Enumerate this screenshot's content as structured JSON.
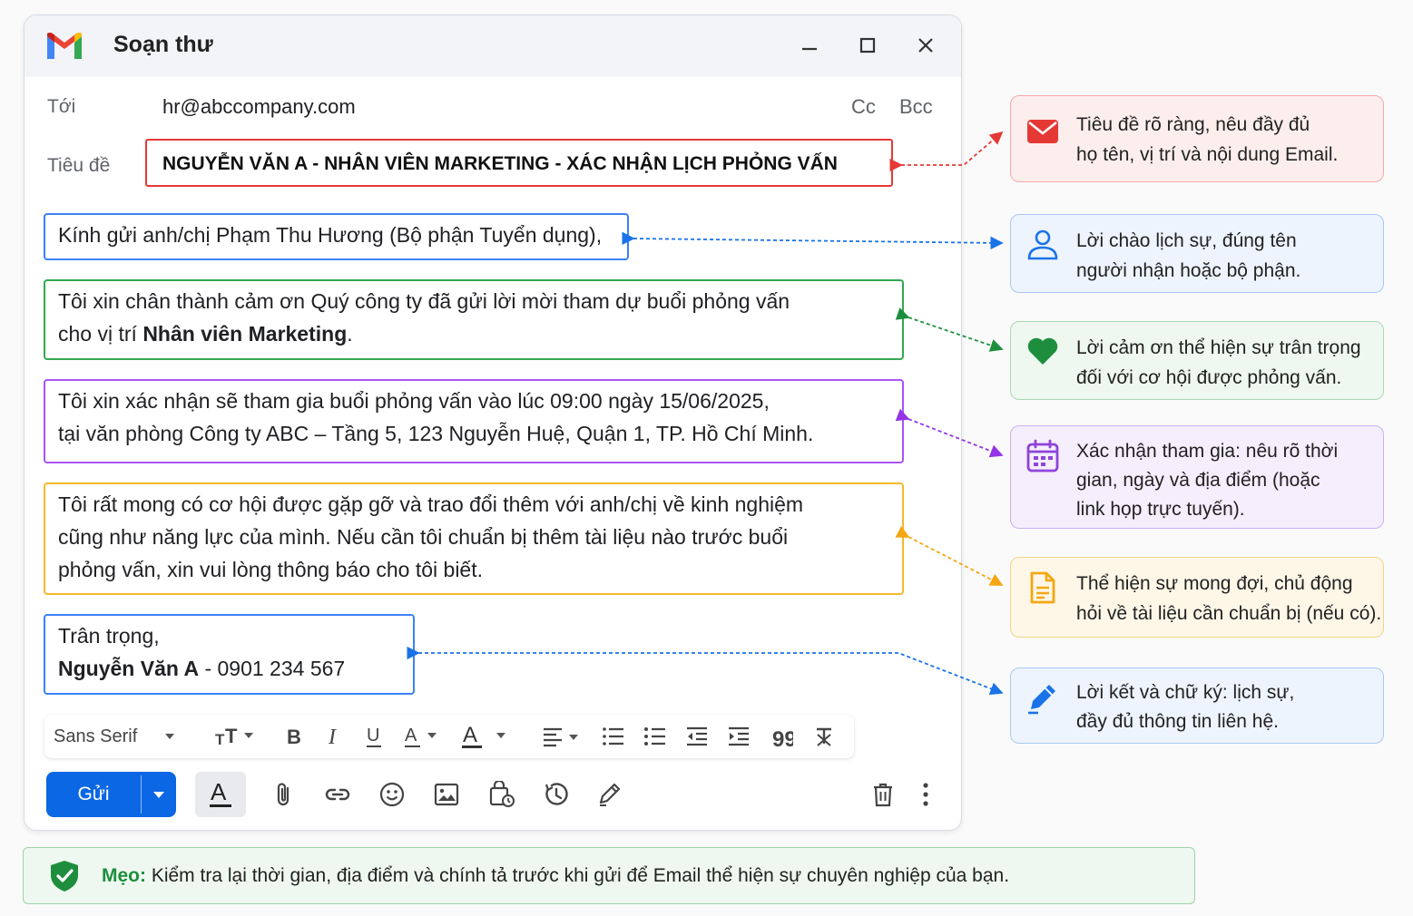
{
  "window": {
    "title": "Soạn thư"
  },
  "compose": {
    "to_label": "Tới",
    "to_value": "hr@abccompany.com",
    "cc": "Cc",
    "bcc": "Bcc",
    "subject_label": "Tiêu đề",
    "subject_value": "NGUYỄN VĂN A - NHÂN VIÊN MARKETING - XÁC NHẬN LỊCH PHỎNG VẤN"
  },
  "body": {
    "greeting": "Kính gửi anh/chị Phạm Thu Hương (Bộ phận Tuyển dụng),",
    "thanks_pre": "Tôi xin chân thành cảm ơn Quý công ty đã gửi lời mời tham dự buổi phỏng vấn",
    "thanks_line2_pre": "cho vị trí ",
    "thanks_bold": "Nhân viên Marketing",
    "thanks_post": ".",
    "confirm_line1": "Tôi xin xác nhận sẽ tham gia buổi phỏng vấn vào lúc 09:00 ngày 15/06/2025,",
    "confirm_line2": "tại văn phòng Công ty ABC – Tầng 5, 123 Nguyễn Huệ, Quận 1, TP. Hồ Chí Minh.",
    "expect_line1": "Tôi rất mong có cơ hội được gặp gỡ và trao đổi thêm với anh/chị về kinh nghiệm",
    "expect_line2": "cũng như năng lực của mình. Nếu cần tôi chuẩn bị thêm tài liệu nào trước buổi",
    "expect_line3": "phỏng vấn, xin vui lòng thông báo cho tôi biết.",
    "closing": "Trân trọng,",
    "sig_name": "Nguyễn Văn A",
    "sig_rest": " - 0901 234 567"
  },
  "toolbar": {
    "font": "Sans Serif"
  },
  "actions": {
    "send": "Gửi"
  },
  "cards": [
    {
      "line1": "Tiêu đề rõ ràng, nêu đầy đủ",
      "line2": "họ tên, vị trí và nội dung Email.",
      "color": "#e53935"
    },
    {
      "line1": "Lời chào lịch sự, đúng tên",
      "line2": "người nhận hoặc bộ phận.",
      "color": "#1a73e8"
    },
    {
      "line1": "Lời cảm ơn thể hiện sự trân trọng",
      "line2": "đối với cơ hội được phỏng vấn.",
      "color": "#1e8e3e"
    },
    {
      "line1": "Xác nhận tham gia: nêu rõ thời",
      "line2": "gian, ngày và địa điểm (hoặc",
      "line3": "link họp trực tuyến).",
      "color": "#8e44d9"
    },
    {
      "line1": "Thể hiện sự mong đợi, chủ động",
      "line2": "hỏi về tài liệu cần chuẩn bị (nếu có).",
      "color": "#f4a712"
    },
    {
      "line1": "Lời kết và chữ ký: lịch sự,",
      "line2": "đầy đủ thông tin liên hệ.",
      "color": "#1a73e8"
    }
  ],
  "tip": {
    "label": "Mẹo:",
    "text": " Kiểm tra lại thời gian, địa điểm và chính tả trước khi gửi để Email thể hiện sự chuyên nghiệp của bạn."
  }
}
